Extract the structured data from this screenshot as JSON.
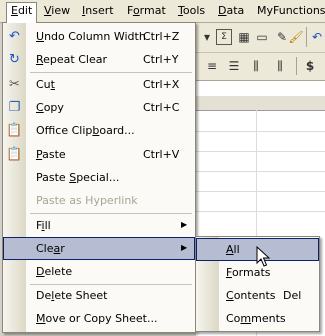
{
  "menubar": {
    "items": [
      {
        "pre": "",
        "acc": "E",
        "post": "dit"
      },
      {
        "pre": "",
        "acc": "V",
        "post": "iew"
      },
      {
        "pre": "",
        "acc": "I",
        "post": "nsert"
      },
      {
        "pre": "F",
        "acc": "o",
        "post": "rmat"
      },
      {
        "pre": "",
        "acc": "T",
        "post": "ools"
      },
      {
        "pre": "",
        "acc": "D",
        "post": "ata"
      },
      {
        "pre": "",
        "acc": "",
        "post": "MyFunctions"
      }
    ]
  },
  "edit_menu": {
    "items": [
      {
        "pre": "",
        "acc": "U",
        "post": "ndo Column Width",
        "shortcut": "Ctrl+Z",
        "icon": "undo-icon"
      },
      {
        "pre": "",
        "acc": "R",
        "post": "epeat Clear",
        "shortcut": "Ctrl+Y",
        "icon": "redo-icon"
      },
      {
        "pre": "Cu",
        "acc": "t",
        "post": "",
        "shortcut": "Ctrl+X",
        "icon": "scissors-icon"
      },
      {
        "pre": "",
        "acc": "C",
        "post": "opy",
        "shortcut": "Ctrl+C",
        "icon": "copy-icon"
      },
      {
        "pre": "Office Clip",
        "acc": "b",
        "post": "oard...",
        "shortcut": "",
        "icon": "clipboard-icon"
      },
      {
        "pre": "",
        "acc": "P",
        "post": "aste",
        "shortcut": "Ctrl+V",
        "icon": "paste-icon"
      },
      {
        "pre": "Paste ",
        "acc": "S",
        "post": "pecial...",
        "shortcut": ""
      },
      {
        "pre": "Paste as ",
        "acc": "H",
        "post": "yperlink",
        "shortcut": ""
      },
      {
        "pre": "F",
        "acc": "i",
        "post": "ll",
        "shortcut": ""
      },
      {
        "pre": "Cle",
        "acc": "a",
        "post": "r",
        "shortcut": ""
      },
      {
        "pre": "",
        "acc": "D",
        "post": "elete",
        "shortcut": ""
      },
      {
        "pre": "De",
        "acc": "l",
        "post": "ete Sheet",
        "shortcut": ""
      },
      {
        "pre": "",
        "acc": "M",
        "post": "ove or Copy Sheet...",
        "shortcut": ""
      }
    ]
  },
  "clear_submenu": {
    "items": [
      {
        "pre": "",
        "acc": "A",
        "post": "ll",
        "shortcut": ""
      },
      {
        "pre": "",
        "acc": "F",
        "post": "ormats",
        "shortcut": ""
      },
      {
        "pre": "",
        "acc": "C",
        "post": "ontents",
        "shortcut": "Del"
      },
      {
        "pre": "Co",
        "acc": "m",
        "post": "ments",
        "shortcut": ""
      }
    ]
  },
  "toolbar": {
    "currency_symbol": "$"
  },
  "colors": {
    "highlight": "#b6bdd2",
    "highlight_border": "#0a246a",
    "menu_bg": "#fbfaf7",
    "disabled_text": "#a8a594"
  }
}
